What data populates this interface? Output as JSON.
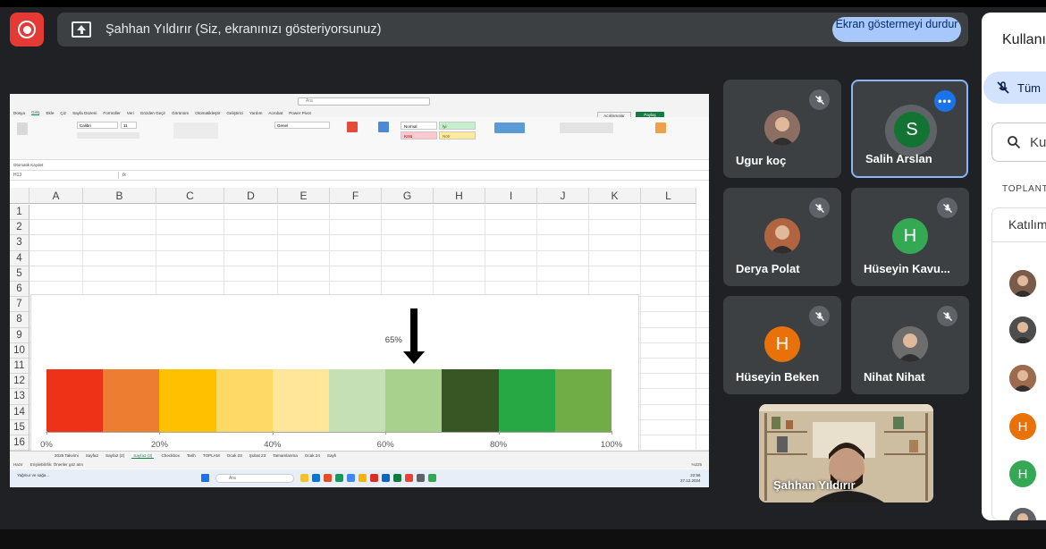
{
  "meeting": {
    "presenting_text": "Şahhan Yıldırır (Siz, ekranınızı gösteriyorsunuz)",
    "stop_button": "Ekran göstermeyi durdur",
    "record_icon": "record-icon",
    "present_icon": "present-screen-icon"
  },
  "side_panel": {
    "title": "Kullanı",
    "mute_all_label": "Tüm",
    "search_placeholder": "Ku",
    "section_label": "TOPLANT",
    "list_header": "Katılım",
    "avatars": [
      {
        "type": "photo",
        "color": "#7a5a48"
      },
      {
        "type": "photo",
        "color": "#4e4e4e"
      },
      {
        "type": "photo",
        "color": "#9c6b4e"
      },
      {
        "type": "letter",
        "letter": "H",
        "color": "#e8710a"
      },
      {
        "type": "letter",
        "letter": "H",
        "color": "#34a853"
      },
      {
        "type": "photo",
        "color": "#5f6368"
      }
    ]
  },
  "participants": [
    {
      "name": "Ugur koç",
      "avatar_type": "photo",
      "avatar_color": "#8d6e63",
      "muted": true,
      "active": false
    },
    {
      "name": "Salih Arslan",
      "avatar_type": "letter",
      "letter": "S",
      "avatar_color": "#137333",
      "muted": false,
      "active": true
    },
    {
      "name": "Derya Polat",
      "avatar_type": "photo",
      "avatar_color": "#b0643f",
      "muted": true,
      "active": false
    },
    {
      "name": "Hüseyin Kavu...",
      "avatar_type": "letter",
      "letter": "H",
      "avatar_color": "#34a853",
      "muted": true,
      "active": false
    },
    {
      "name": "Hüseyin Beken",
      "avatar_type": "letter",
      "letter": "H",
      "avatar_color": "#e8710a",
      "muted": true,
      "active": false
    },
    {
      "name": "Nihat Nihat",
      "avatar_type": "photo",
      "avatar_color": "#6d6d6d",
      "muted": true,
      "active": false
    }
  ],
  "self_view": {
    "name": "Şahhan Yıldırır"
  },
  "excel": {
    "search": "Ara",
    "menu": [
      "Dosya",
      "Giriş",
      "Ekle",
      "Çiz",
      "Sayfa Düzeni",
      "Formüller",
      "Veri",
      "Gözden Geçir",
      "Görünüm",
      "Otomatikleştir",
      "Geliştirici",
      "Yardım",
      "Acrobat",
      "Power Pivot"
    ],
    "active_menu": "Giriş",
    "comments": "Açıklamalar",
    "share": "Paylaş",
    "font": "Calibri",
    "font_size": "11",
    "number_format": "Genel",
    "styles": [
      {
        "label": "Normal",
        "bg": "#ffffff",
        "fg": "#000000"
      },
      {
        "label": "İyi",
        "bg": "#c6efce",
        "fg": "#006100"
      },
      {
        "label": "Kötü",
        "bg": "#ffc7ce",
        "fg": "#9c0006"
      },
      {
        "label": "Nötr",
        "bg": "#ffeb9c",
        "fg": "#9c5700"
      }
    ],
    "name_box": "H13",
    "fx": "fx",
    "autosave": "Otomatik Kaydet",
    "columns": [
      "A",
      "B",
      "C",
      "D",
      "E",
      "F",
      "G",
      "H",
      "I",
      "J",
      "K",
      "L"
    ],
    "rows": [
      "1",
      "2",
      "3",
      "4",
      "5",
      "6",
      "7",
      "8",
      "9",
      "10",
      "11",
      "12",
      "13",
      "14",
      "15",
      "16"
    ],
    "sheets": [
      "2025 Takvimi",
      "Sayfa2",
      "Sayfa2 (2)",
      "Sayfa3 (3)",
      "Checkbox",
      "Tarih",
      "TOPLAM",
      "Ocak 23",
      "Şubat 23",
      "Tamamlanma",
      "Ocak 24",
      "Sayfı"
    ],
    "active_sheet": "Sayfa3 (3)",
    "status": "Hazır",
    "accessibility": "Erişilebilirlik: Öneriler göz atın",
    "zoom": "%225",
    "taskbar_search": "Ara",
    "clock_time": "22:56",
    "clock_date": "27.12.2024",
    "weather": "Yağmur ve sağa..."
  },
  "chart_data": {
    "type": "bar",
    "title": "",
    "segments": [
      {
        "from": 0,
        "to": 10,
        "color": "#ee3218"
      },
      {
        "from": 10,
        "to": 20,
        "color": "#ed7d31"
      },
      {
        "from": 20,
        "to": 30,
        "color": "#ffc000"
      },
      {
        "from": 30,
        "to": 40,
        "color": "#ffd966"
      },
      {
        "from": 40,
        "to": 50,
        "color": "#ffe699"
      },
      {
        "from": 50,
        "to": 60,
        "color": "#c5e0b4"
      },
      {
        "from": 60,
        "to": 70,
        "color": "#a9d18e"
      },
      {
        "from": 70,
        "to": 80,
        "color": "#375623"
      },
      {
        "from": 80,
        "to": 90,
        "color": "#28a745"
      },
      {
        "from": 90,
        "to": 100,
        "color": "#70ad47"
      }
    ],
    "x_ticks": [
      "0%",
      "20%",
      "40%",
      "60%",
      "80%",
      "100%"
    ],
    "x_tick_values": [
      0,
      20,
      40,
      60,
      80,
      100
    ],
    "xlim": [
      0,
      100
    ],
    "marker_value": 65,
    "marker_label": "65%"
  }
}
